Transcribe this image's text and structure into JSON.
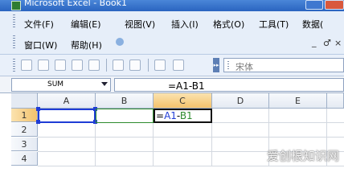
{
  "window": {
    "title": "Microsoft Excel - Book1"
  },
  "menubar": {
    "items": [
      {
        "id": "file",
        "label": "文件(F)"
      },
      {
        "id": "edit",
        "label": "编辑(E)"
      },
      {
        "id": "view",
        "label": "视图(V)"
      },
      {
        "id": "insert",
        "label": "插入(I)"
      },
      {
        "id": "format",
        "label": "格式(O)"
      },
      {
        "id": "tools",
        "label": "工具(T)"
      },
      {
        "id": "data",
        "label": "数据("
      }
    ],
    "items_row2": [
      {
        "id": "window",
        "label": "窗口(W)"
      },
      {
        "id": "help",
        "label": "帮助(H)"
      }
    ],
    "doc_controls": [
      "_",
      "♂",
      "×"
    ]
  },
  "toolbar": {
    "font_name": "宋体",
    "toggle_glyph": "▸▸"
  },
  "formula_bar": {
    "name_box": "SUM",
    "formula": "=A1-B1"
  },
  "grid": {
    "columns": [
      "A",
      "B",
      "C",
      "D",
      "E"
    ],
    "rows": [
      "1",
      "2",
      "3",
      "4"
    ],
    "active_cell": "C1",
    "cells": {
      "C1": {
        "prefix": "=",
        "ref1": "A1",
        "op": "-",
        "ref2": "B1"
      }
    }
  },
  "watermark": "爱创根知识网",
  "colors": {
    "title_bar": "#2a64c0",
    "ref_a1": "#1f3cd6",
    "ref_b1": "#2e8b2e",
    "selected_header": "#f3c26c"
  }
}
